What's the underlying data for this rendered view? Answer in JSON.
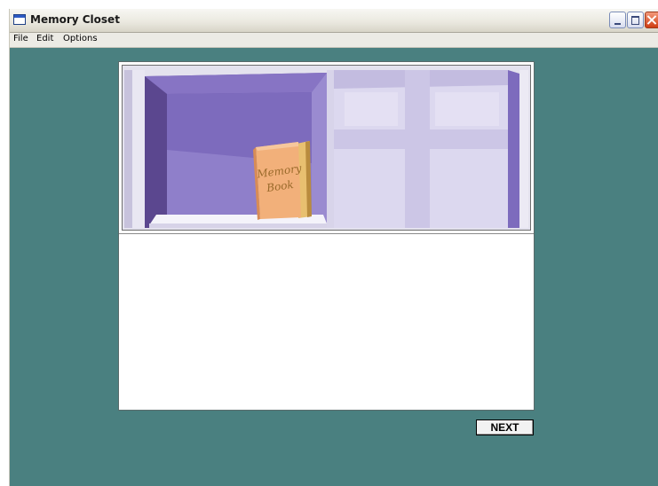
{
  "window": {
    "title": "Memory Closet",
    "icon": "app-window-icon",
    "controls": [
      "minimize",
      "maximize",
      "close"
    ]
  },
  "menubar": {
    "items": [
      {
        "label": "File"
      },
      {
        "label": "Edit"
      },
      {
        "label": "Options"
      }
    ]
  },
  "illustration": {
    "subject": "closet-shelf-with-book",
    "book_title_line1": "Memory",
    "book_title_line2": "Book"
  },
  "text_area": {
    "content": ""
  },
  "buttons": {
    "next_label": "NEXT"
  },
  "colors": {
    "desktop": "#4a8080",
    "closet_purple": "#7e6ab8",
    "closet_light": "#d6d0ec",
    "book_cover": "#f2b07a"
  }
}
